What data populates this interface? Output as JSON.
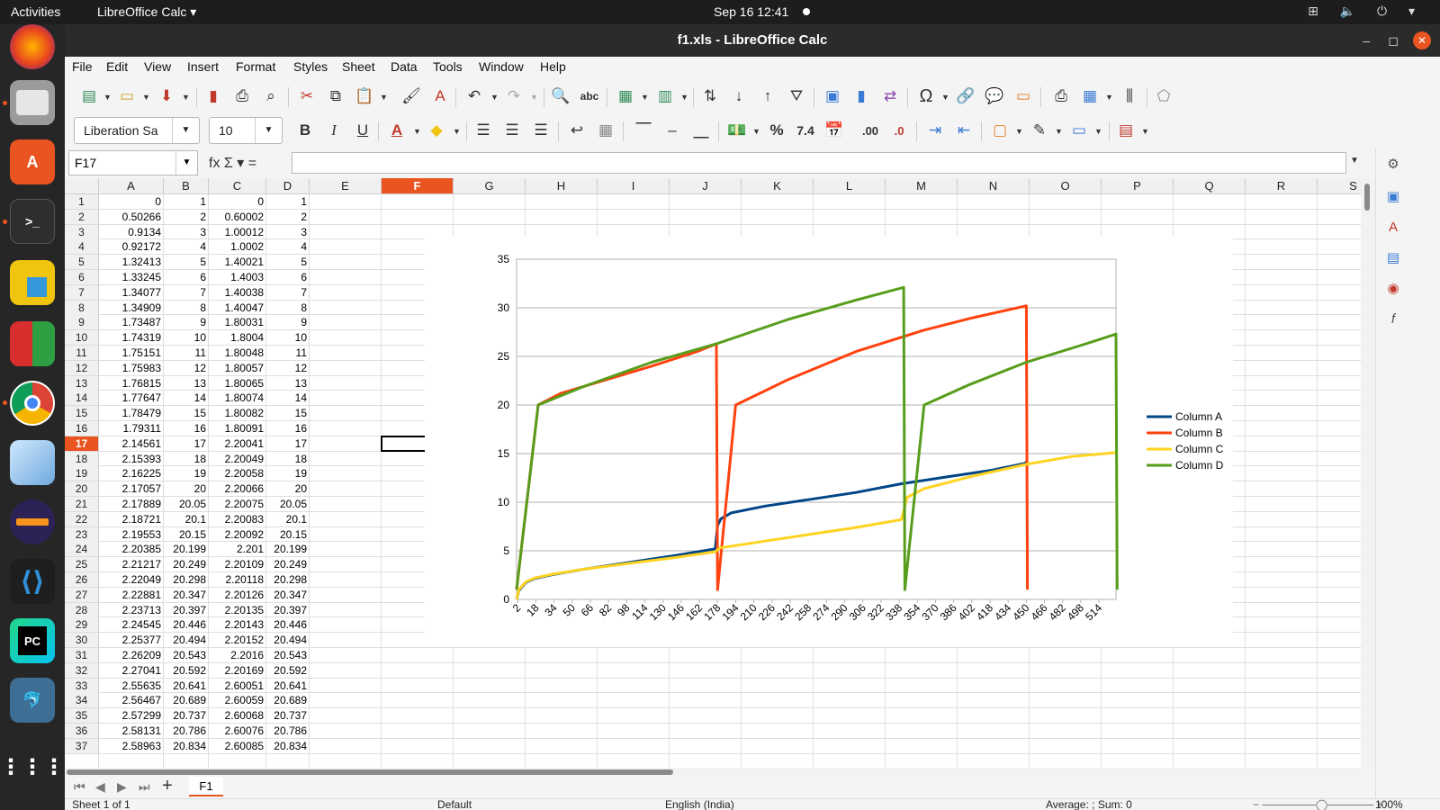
{
  "topbar": {
    "activities": "Activities",
    "app_menu": "LibreOffice Calc ▾",
    "clock": "Sep 16  12:41",
    "tray": "⊞ 🔈 ⏻ ▾"
  },
  "window": {
    "title": "f1.xls - LibreOffice Calc",
    "minimize": "–",
    "maximize": "◻",
    "close": "✕"
  },
  "menu": [
    "File",
    "Edit",
    "View",
    "Insert",
    "Format",
    "Styles",
    "Sheet",
    "Data",
    "Tools",
    "Window",
    "Help"
  ],
  "font": {
    "name": "Liberation Sa",
    "size": "10"
  },
  "formula": {
    "namebox": "F17",
    "fx_icons": "fx  Σ ▾  =",
    "content": ""
  },
  "columns": [
    "A",
    "B",
    "C",
    "D",
    "E",
    "F",
    "G",
    "H",
    "I",
    "J",
    "K",
    "L",
    "M",
    "N",
    "O",
    "P",
    "Q",
    "R",
    "S"
  ],
  "selected_column": "F",
  "selected_row": "17",
  "rows": [
    [
      "1",
      "0",
      "1",
      "0",
      "1"
    ],
    [
      "2",
      "0.50266",
      "2",
      "0.60002",
      "2"
    ],
    [
      "3",
      "0.9134",
      "3",
      "1.00012",
      "3"
    ],
    [
      "4",
      "0.92172",
      "4",
      "1.0002",
      "4"
    ],
    [
      "5",
      "1.32413",
      "5",
      "1.40021",
      "5"
    ],
    [
      "6",
      "1.33245",
      "6",
      "1.4003",
      "6"
    ],
    [
      "7",
      "1.34077",
      "7",
      "1.40038",
      "7"
    ],
    [
      "8",
      "1.34909",
      "8",
      "1.40047",
      "8"
    ],
    [
      "9",
      "1.73487",
      "9",
      "1.80031",
      "9"
    ],
    [
      "10",
      "1.74319",
      "10",
      "1.8004",
      "10"
    ],
    [
      "11",
      "1.75151",
      "11",
      "1.80048",
      "11"
    ],
    [
      "12",
      "1.75983",
      "12",
      "1.80057",
      "12"
    ],
    [
      "13",
      "1.76815",
      "13",
      "1.80065",
      "13"
    ],
    [
      "14",
      "1.77647",
      "14",
      "1.80074",
      "14"
    ],
    [
      "15",
      "1.78479",
      "15",
      "1.80082",
      "15"
    ],
    [
      "16",
      "1.79311",
      "16",
      "1.80091",
      "16"
    ],
    [
      "17",
      "2.14561",
      "17",
      "2.20041",
      "17"
    ],
    [
      "18",
      "2.15393",
      "18",
      "2.20049",
      "18"
    ],
    [
      "19",
      "2.16225",
      "19",
      "2.20058",
      "19"
    ],
    [
      "20",
      "2.17057",
      "20",
      "2.20066",
      "20"
    ],
    [
      "21",
      "2.17889",
      "20.05",
      "2.20075",
      "20.05"
    ],
    [
      "22",
      "2.18721",
      "20.1",
      "2.20083",
      "20.1"
    ],
    [
      "23",
      "2.19553",
      "20.15",
      "2.20092",
      "20.15"
    ],
    [
      "24",
      "2.20385",
      "20.199",
      "2.201",
      "20.199"
    ],
    [
      "25",
      "2.21217",
      "20.249",
      "2.20109",
      "20.249"
    ],
    [
      "26",
      "2.22049",
      "20.298",
      "2.20118",
      "20.298"
    ],
    [
      "27",
      "2.22881",
      "20.347",
      "2.20126",
      "20.347"
    ],
    [
      "28",
      "2.23713",
      "20.397",
      "2.20135",
      "20.397"
    ],
    [
      "29",
      "2.24545",
      "20.446",
      "2.20143",
      "20.446"
    ],
    [
      "30",
      "2.25377",
      "20.494",
      "2.20152",
      "20.494"
    ],
    [
      "31",
      "2.26209",
      "20.543",
      "2.2016",
      "20.543"
    ],
    [
      "32",
      "2.27041",
      "20.592",
      "2.20169",
      "20.592"
    ],
    [
      "33",
      "2.55635",
      "20.641",
      "2.60051",
      "20.641"
    ],
    [
      "34",
      "2.56467",
      "20.689",
      "2.60059",
      "20.689"
    ],
    [
      "35",
      "2.57299",
      "20.737",
      "2.60068",
      "20.737"
    ],
    [
      "36",
      "2.58131",
      "20.786",
      "2.60076",
      "20.786"
    ],
    [
      "37",
      "2.58963",
      "20.834",
      "2.60085",
      "20.834"
    ]
  ],
  "sheet_tab": "F1",
  "status": {
    "sheet": "Sheet 1 of 1",
    "style": "Default",
    "language": "English (India)",
    "summary": "Average: ; Sum: 0",
    "zoom": "100%"
  },
  "chart_data": {
    "type": "line",
    "ylim": [
      0,
      35
    ],
    "yticks": [
      0,
      5,
      10,
      15,
      20,
      25,
      30,
      35
    ],
    "xtick_labels": [
      "2",
      "18",
      "34",
      "50",
      "66",
      "82",
      "98",
      "114",
      "130",
      "146",
      "162",
      "178",
      "194",
      "210",
      "226",
      "242",
      "258",
      "274",
      "290",
      "306",
      "322",
      "338",
      "354",
      "370",
      "386",
      "402",
      "418",
      "434",
      "450",
      "466",
      "482",
      "498",
      "514"
    ],
    "x_range": [
      1,
      529
    ],
    "series": [
      {
        "name": "Column A",
        "color": "#004586",
        "points": [
          [
            1,
            0
          ],
          [
            3,
            0.9
          ],
          [
            9,
            1.73
          ],
          [
            17,
            2.15
          ],
          [
            33,
            2.56
          ],
          [
            60,
            3.1
          ],
          [
            100,
            3.8
          ],
          [
            140,
            4.5
          ],
          [
            176,
            5.2
          ],
          [
            178,
            7.6
          ],
          [
            181,
            8.3
          ],
          [
            190,
            8.9
          ],
          [
            220,
            9.6
          ],
          [
            260,
            10.3
          ],
          [
            300,
            11.0
          ],
          [
            340,
            11.9
          ],
          [
            380,
            12.6
          ],
          [
            420,
            13.3
          ],
          [
            449,
            14.0
          ],
          [
            451,
            14.3
          ]
        ]
      },
      {
        "name": "Column B",
        "color": "#ff420e",
        "points": [
          [
            1,
            1
          ],
          [
            3,
            3
          ],
          [
            20,
            20
          ],
          [
            40,
            21.2
          ],
          [
            80,
            22.6
          ],
          [
            120,
            24.0
          ],
          [
            160,
            25.5
          ],
          [
            177,
            26.3
          ],
          [
            178,
            1
          ],
          [
            194,
            20
          ],
          [
            240,
            22.6
          ],
          [
            300,
            25.5
          ],
          [
            360,
            27.7
          ],
          [
            400,
            28.9
          ],
          [
            450,
            30.2
          ],
          [
            451,
            1
          ]
        ]
      },
      {
        "name": "Column C",
        "color": "#ffd320",
        "points": [
          [
            1,
            0
          ],
          [
            3,
            1.0
          ],
          [
            9,
            1.8
          ],
          [
            17,
            2.2
          ],
          [
            33,
            2.6
          ],
          [
            60,
            3.1
          ],
          [
            100,
            3.7
          ],
          [
            140,
            4.3
          ],
          [
            176,
            4.9
          ],
          [
            180,
            5.3
          ],
          [
            220,
            6.0
          ],
          [
            260,
            6.7
          ],
          [
            300,
            7.4
          ],
          [
            340,
            8.2
          ],
          [
            345,
            10.5
          ],
          [
            360,
            11.4
          ],
          [
            400,
            12.6
          ],
          [
            450,
            13.9
          ],
          [
            490,
            14.7
          ],
          [
            529,
            15.1
          ]
        ]
      },
      {
        "name": "Column D",
        "color": "#579d1c",
        "points": [
          [
            1,
            1
          ],
          [
            3,
            3
          ],
          [
            20,
            20
          ],
          [
            60,
            21.9
          ],
          [
            120,
            24.4
          ],
          [
            177,
            26.3
          ],
          [
            240,
            28.8
          ],
          [
            300,
            30.8
          ],
          [
            342,
            32.1
          ],
          [
            343,
            1
          ],
          [
            360,
            20
          ],
          [
            400,
            22.1
          ],
          [
            450,
            24.4
          ],
          [
            500,
            26.2
          ],
          [
            529,
            27.3
          ],
          [
            530,
            1
          ]
        ]
      }
    ]
  }
}
